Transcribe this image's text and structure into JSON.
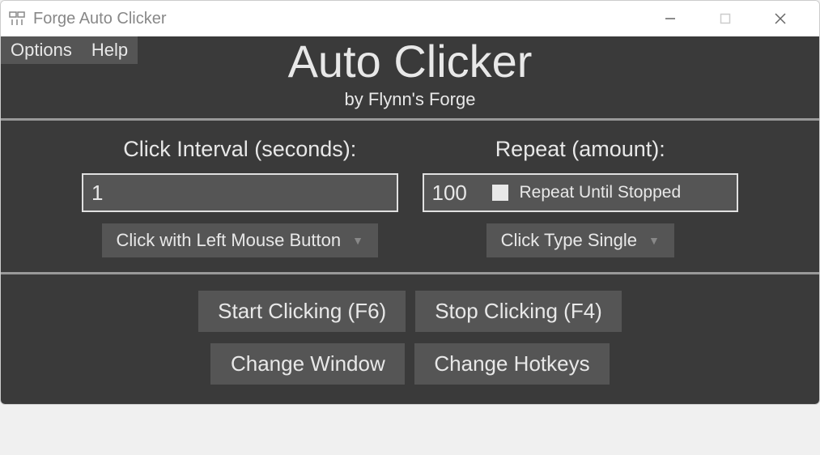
{
  "window": {
    "title": "Forge Auto Clicker"
  },
  "menubar": {
    "options": "Options",
    "help": "Help"
  },
  "header": {
    "title": "Auto Clicker",
    "subtitle": "by Flynn's Forge"
  },
  "interval": {
    "label": "Click Interval (seconds):",
    "value": "1",
    "dropdown": "Click with Left Mouse Button"
  },
  "repeat": {
    "label": "Repeat (amount):",
    "value": "100",
    "checkbox_label": "Repeat Until Stopped",
    "dropdown": "Click Type Single"
  },
  "buttons": {
    "start": "Start Clicking (F6)",
    "stop": "Stop Clicking (F4)",
    "change_window": "Change Window",
    "change_hotkeys": "Change Hotkeys"
  }
}
